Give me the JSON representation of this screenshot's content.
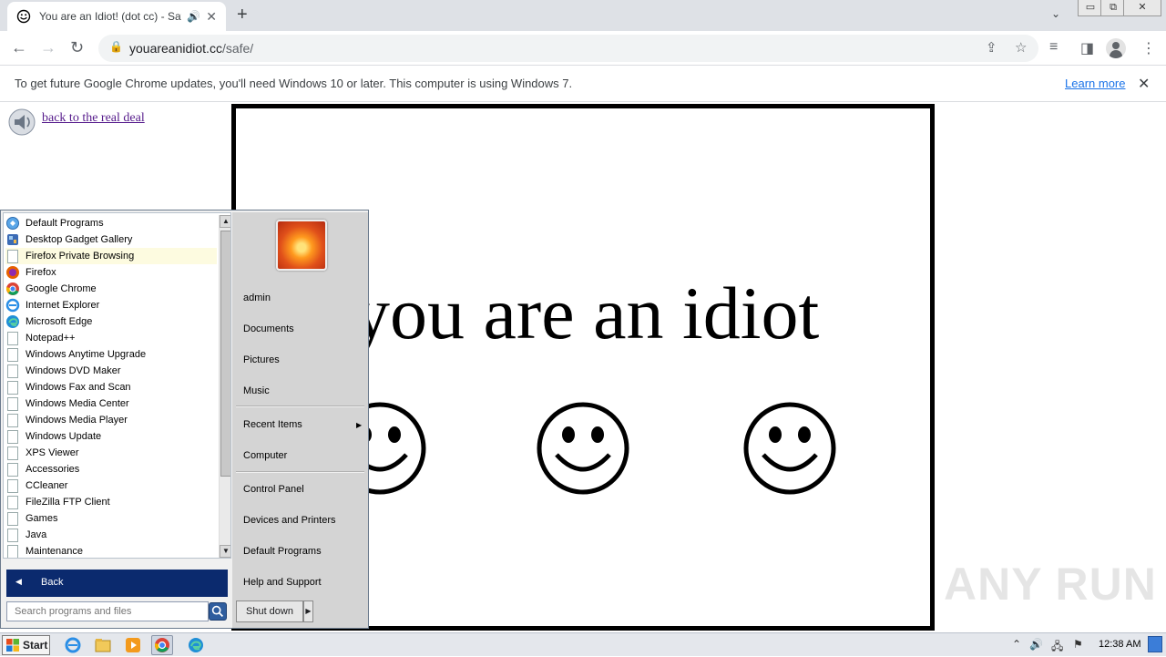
{
  "browser": {
    "tab": {
      "title": "You are an Idiot! (dot cc) - Safe",
      "audio_icon": "speaker-icon",
      "close": "✕"
    },
    "new_tab": "+",
    "tab_dropdown": "⌄",
    "window_controls": {
      "minimize": "▭",
      "restore": "⧉",
      "close": "✕"
    },
    "toolbar": {
      "back": "←",
      "forward": "→",
      "reload": "↻"
    },
    "url": {
      "domain": "youareanidiot.cc",
      "path": "/safe/"
    }
  },
  "infobar": {
    "message": "To get future Google Chrome updates, you'll need Windows 10 or later. This computer is using Windows 7.",
    "learn_more": "Learn more",
    "close": "✕"
  },
  "page": {
    "back_link": "back to the real deal",
    "headline": "you are an idiot",
    "smiley_count": 3
  },
  "start_menu": {
    "programs": [
      {
        "label": "Default Programs",
        "icon": "default-programs-icon"
      },
      {
        "label": "Desktop Gadget Gallery",
        "icon": "gadget-icon"
      },
      {
        "label": "Firefox Private Browsing",
        "icon": "file-icon",
        "highlighted": true
      },
      {
        "label": "Firefox",
        "icon": "firefox-icon"
      },
      {
        "label": "Google Chrome",
        "icon": "chrome-icon"
      },
      {
        "label": "Internet Explorer",
        "icon": "ie-icon"
      },
      {
        "label": "Microsoft Edge",
        "icon": "edge-icon"
      },
      {
        "label": "Notepad++",
        "icon": "file-icon"
      },
      {
        "label": "Windows Anytime Upgrade",
        "icon": "file-icon"
      },
      {
        "label": "Windows DVD Maker",
        "icon": "file-icon"
      },
      {
        "label": "Windows Fax and Scan",
        "icon": "file-icon"
      },
      {
        "label": "Windows Media Center",
        "icon": "file-icon"
      },
      {
        "label": "Windows Media Player",
        "icon": "file-icon"
      },
      {
        "label": "Windows Update",
        "icon": "file-icon"
      },
      {
        "label": "XPS Viewer",
        "icon": "file-icon"
      },
      {
        "label": "Accessories",
        "icon": "file-icon"
      },
      {
        "label": "CCleaner",
        "icon": "file-icon"
      },
      {
        "label": "FileZilla FTP Client",
        "icon": "file-icon"
      },
      {
        "label": "Games",
        "icon": "file-icon"
      },
      {
        "label": "Java",
        "icon": "file-icon"
      },
      {
        "label": "Maintenance",
        "icon": "file-icon"
      }
    ],
    "back": "Back",
    "search_placeholder": "Search programs and files",
    "right": {
      "user": "admin",
      "documents": "Documents",
      "pictures": "Pictures",
      "music": "Music",
      "recent_items": "Recent Items",
      "computer": "Computer",
      "control_panel": "Control Panel",
      "devices_printers": "Devices and Printers",
      "default_programs": "Default Programs",
      "help_support": "Help and Support"
    },
    "shutdown": "Shut down"
  },
  "watermark": "ANY RUN",
  "taskbar": {
    "start": "Start",
    "apps": [
      "ie-icon",
      "explorer-icon",
      "media-player-icon",
      "chrome-icon",
      "edge-icon"
    ],
    "clock": "12:38 AM"
  }
}
